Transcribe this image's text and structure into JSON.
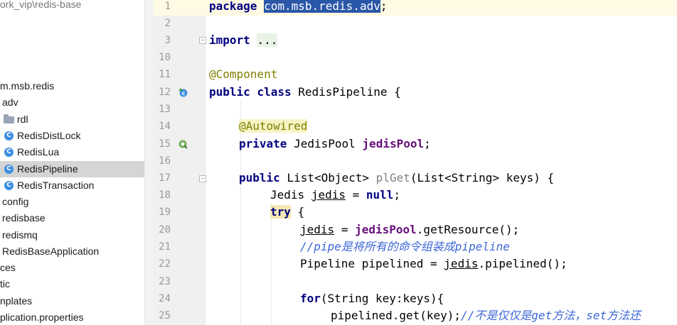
{
  "project_tree": {
    "items": [
      {
        "label": "ork_vip\\redis-base",
        "type": "path"
      },
      {
        "label": "m.msb.redis",
        "type": "package"
      },
      {
        "label": "adv",
        "type": "package"
      },
      {
        "label": "rdl",
        "type": "folder"
      },
      {
        "label": "RedisDistLock",
        "type": "class"
      },
      {
        "label": "RedisLua",
        "type": "class"
      },
      {
        "label": "RedisPipeline",
        "type": "class",
        "selected": true
      },
      {
        "label": "RedisTransaction",
        "type": "class"
      },
      {
        "label": "config",
        "type": "package"
      },
      {
        "label": "redisbase",
        "type": "package"
      },
      {
        "label": "redismq",
        "type": "package"
      },
      {
        "label": "RedisBaseApplication",
        "type": "class"
      },
      {
        "label": "ces",
        "type": "folder"
      },
      {
        "label": "tic",
        "type": "folder"
      },
      {
        "label": "nplates",
        "type": "folder"
      },
      {
        "label": "plication.properties",
        "type": "file"
      }
    ]
  },
  "editor": {
    "line_numbers": [
      "1",
      "2",
      "3",
      "10",
      "11",
      "12",
      "13",
      "14",
      "15",
      "16",
      "17",
      "18",
      "19",
      "20",
      "21",
      "22",
      "23",
      "24",
      "25"
    ],
    "lines": {
      "l1": {
        "kw": "package",
        "sel": "com.msb.redis.adv",
        "end": ";"
      },
      "l3": {
        "kw": "import",
        "dots": "..."
      },
      "l11": {
        "ann": "@Component"
      },
      "l12": {
        "kw": "public class",
        "rest": "RedisPipeline {"
      },
      "l14": {
        "ann": "@Autowired"
      },
      "l15": {
        "kw": "private",
        "type": "JedisPool",
        "field": "jedisPool",
        "end": ";"
      },
      "l17": {
        "kw": "public",
        "type": "List<Object>",
        "method": "plGet",
        "rest": "(List<String> keys) {"
      },
      "l18": {
        "type": "Jedis",
        "var": "jedis",
        "eq": "=",
        "kw": "null",
        "end": ";"
      },
      "l19": {
        "kw": "try",
        "rest": "{"
      },
      "l20": {
        "var": "jedis",
        "eq": "=",
        "field": "jedisPool",
        "rest": ".getResource();"
      },
      "l21": {
        "comment": "//pipe是将所有的命令组装成pipeline"
      },
      "l22": {
        "type": "Pipeline pipelined =",
        "var": "jedis",
        "rest": ".pipelined();"
      },
      "l24": {
        "kw": "for",
        "rest": "(String key:keys){"
      },
      "l25": {
        "rest": "pipelined.get(key);",
        "comment": "//不是仅仅是get方法，set方法还"
      }
    }
  },
  "colors": {
    "keyword": "#000080",
    "annotation": "#808000",
    "field": "#660e7a",
    "comment": "#3c66d6",
    "selection": "#2b57a8"
  },
  "icons": {
    "class_icon": "class-c-icon",
    "gutter_class": "implemented-class-icon",
    "gutter_bean": "autowired-bean-icon"
  }
}
